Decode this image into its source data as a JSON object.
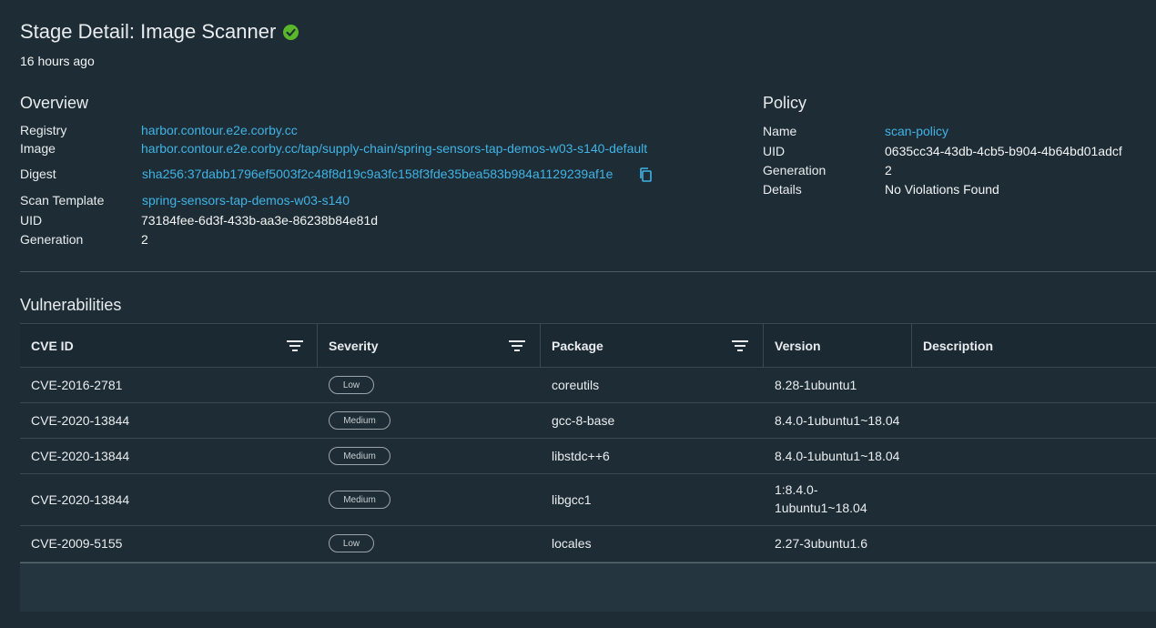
{
  "header": {
    "title": "Stage Detail: Image Scanner",
    "status_icon": "check-circle-icon",
    "status_color": "#5ab72b",
    "time_ago": "16 hours ago"
  },
  "overview": {
    "title": "Overview",
    "registry_label": "Registry",
    "registry_value": "harbor.contour.e2e.corby.cc",
    "image_label": "Image",
    "image_value": "harbor.contour.e2e.corby.cc/tap/supply-chain/spring-sensors-tap-demos-w03-s140-default",
    "digest_label": "Digest",
    "digest_value": "sha256:37dabb1796ef5003f2c48f8d19c9a3fc158f3fde35bea583b984a1129239af1e",
    "scan_template_label": "Scan Template",
    "scan_template_value": "spring-sensors-tap-demos-w03-s140",
    "uid_label": "UID",
    "uid_value": "73184fee-6d3f-433b-aa3e-86238b84e81d",
    "generation_label": "Generation",
    "generation_value": "2"
  },
  "policy": {
    "title": "Policy",
    "name_label": "Name",
    "name_value": "scan-policy",
    "uid_label": "UID",
    "uid_value": "0635cc34-43db-4cb5-b904-4b64bd01adcf",
    "generation_label": "Generation",
    "generation_value": "2",
    "details_label": "Details",
    "details_value": "No Violations Found"
  },
  "vulnerabilities": {
    "title": "Vulnerabilities",
    "columns": [
      {
        "label": "CVE ID",
        "filter_icon": "filter-icon"
      },
      {
        "label": "Severity",
        "filter_icon": "filter-icon"
      },
      {
        "label": "Package",
        "filter_icon": "filter-icon"
      },
      {
        "label": "Version"
      },
      {
        "label": "Description"
      }
    ],
    "rows": [
      {
        "cve": "CVE-2016-2781",
        "severity": "Low",
        "package": "coreutils",
        "version_line1": "8.28-1ubuntu1",
        "version_line2": ""
      },
      {
        "cve": "CVE-2020-13844",
        "severity": "Medium",
        "package": "gcc-8-base",
        "version_line1": "8.4.0-1ubuntu1~18.04",
        "version_line2": ""
      },
      {
        "cve": "CVE-2020-13844",
        "severity": "Medium",
        "package": "libstdc++6",
        "version_line1": "8.4.0-1ubuntu1~18.04",
        "version_line2": ""
      },
      {
        "cve": "CVE-2020-13844",
        "severity": "Medium",
        "package": "libgcc1",
        "version_line1": "1:8.4.0-",
        "version_line2": "1ubuntu1~18.04"
      },
      {
        "cve": "CVE-2009-5155",
        "severity": "Low",
        "package": "locales",
        "version_line1": "2.27-3ubuntu1.6",
        "version_line2": ""
      }
    ]
  },
  "colors": {
    "background": "#1e2d35",
    "link": "#3fb3e6",
    "table_header": "#1b2a32"
  }
}
